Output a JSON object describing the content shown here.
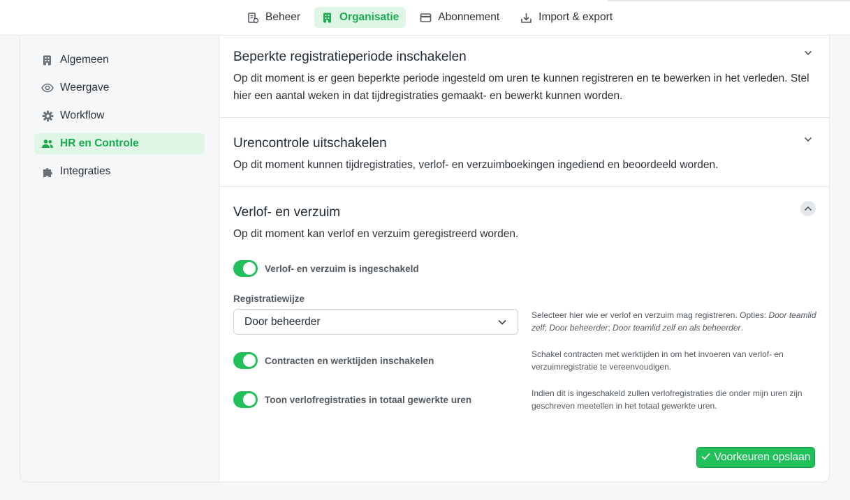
{
  "nav": {
    "tabs": [
      {
        "label": "Beheer",
        "icon": "building-gear-icon",
        "active": false
      },
      {
        "label": "Organisatie",
        "icon": "building-icon",
        "active": true
      },
      {
        "label": "Abonnement",
        "icon": "credit-card-icon",
        "active": false
      },
      {
        "label": "Import & export",
        "icon": "download-icon",
        "active": false
      }
    ]
  },
  "sidebar": {
    "items": [
      {
        "label": "Algemeen",
        "icon": "building-icon"
      },
      {
        "label": "Weergave",
        "icon": "eye-icon"
      },
      {
        "label": "Workflow",
        "icon": "gear-icon"
      },
      {
        "label": "HR en Controle",
        "icon": "users-icon",
        "active": true
      },
      {
        "label": "Integraties",
        "icon": "puzzle-icon"
      }
    ]
  },
  "sections": {
    "period": {
      "title": "Beperkte registratieperiode inschakelen",
      "description": "Op dit moment is er geen beperkte periode ingesteld om uren te kunnen registreren en te bewerken in het verleden. Stel hier een aantal weken in dat tijdregistraties gemaakt- en bewerkt kunnen worden."
    },
    "control": {
      "title": "Urencontrole uitschakelen",
      "description": "Op dit moment kunnen tijdregistraties, verlof- en verzuimboekingen ingediend en beoordeeld worden."
    },
    "leave": {
      "title": "Verlof- en verzuim",
      "description": "Op dit moment kan verlof en verzuim geregistreerd worden.",
      "toggle_enabled_label": "Verlof- en verzuim is ingeschakeld",
      "registration_label": "Registratiewijze",
      "registration_value": "Door beheerder",
      "registration_help_prefix": "Selecteer hier wie er verlof en verzuim mag registreren. Opties: ",
      "registration_help_opt1": "Door teamlid zelf",
      "registration_help_sep1": "; ",
      "registration_help_opt2": "Door beheerder",
      "registration_help_sep2": "; ",
      "registration_help_opt3": "Door teamlid zelf en als beheerder",
      "registration_help_suffix": ".",
      "contracts_label": "Contracten en werktijden inschakelen",
      "contracts_help": "Schakel contracten met werktijden in om het invoeren van verlof- en verzuimregistratie te vereenvoudigen.",
      "show_leave_label": "Toon verlofregistraties in totaal gewerkte uren",
      "show_leave_help": "Indien dit is ingeschakeld zullen verlofregistraties die onder mijn uren zijn geschreven meetellen in het totaal gewerkte uren.",
      "save_label": "Voorkeuren opslaan"
    }
  },
  "colors": {
    "accent": "#20c05a",
    "accent_text": "#1bab4e",
    "accent_bg": "#dff5e6"
  }
}
